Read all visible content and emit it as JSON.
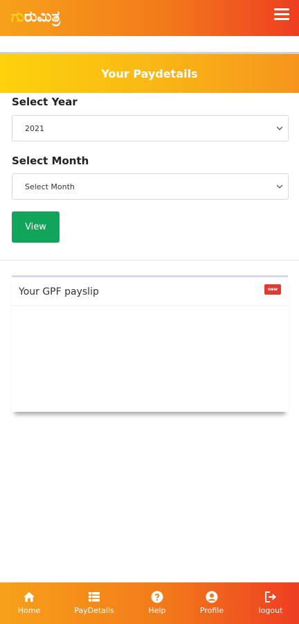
{
  "app": {
    "logo_first": "ಗು",
    "logo_rest": "ರುಮಿತ್ರ"
  },
  "header": {
    "menu_icon": "hamburger-menu-icon"
  },
  "banner": {
    "title": "Your Paydetails"
  },
  "form": {
    "year_label": "Select Year",
    "year_value": "2021",
    "month_label": "Select Month",
    "month_value": "Select Month",
    "view_button": "View"
  },
  "card": {
    "title": "Your GPF payslip",
    "badge": "new"
  },
  "bottom_nav": {
    "items": [
      {
        "label": "Home",
        "icon": "home-icon"
      },
      {
        "label": "PayDetails",
        "icon": "list-icon"
      },
      {
        "label": "Help",
        "icon": "help-icon"
      },
      {
        "label": "Profile",
        "icon": "profile-icon"
      },
      {
        "label": "logout",
        "icon": "logout-icon"
      }
    ]
  },
  "colors": {
    "header_gradient_start": "#f7a11a",
    "header_gradient_end": "#ef3d22",
    "banner_gradient_start": "#fdd20b",
    "banner_gradient_end": "#f6941d",
    "button_green": "#10a55a",
    "badge_red": "#dd3b33"
  }
}
